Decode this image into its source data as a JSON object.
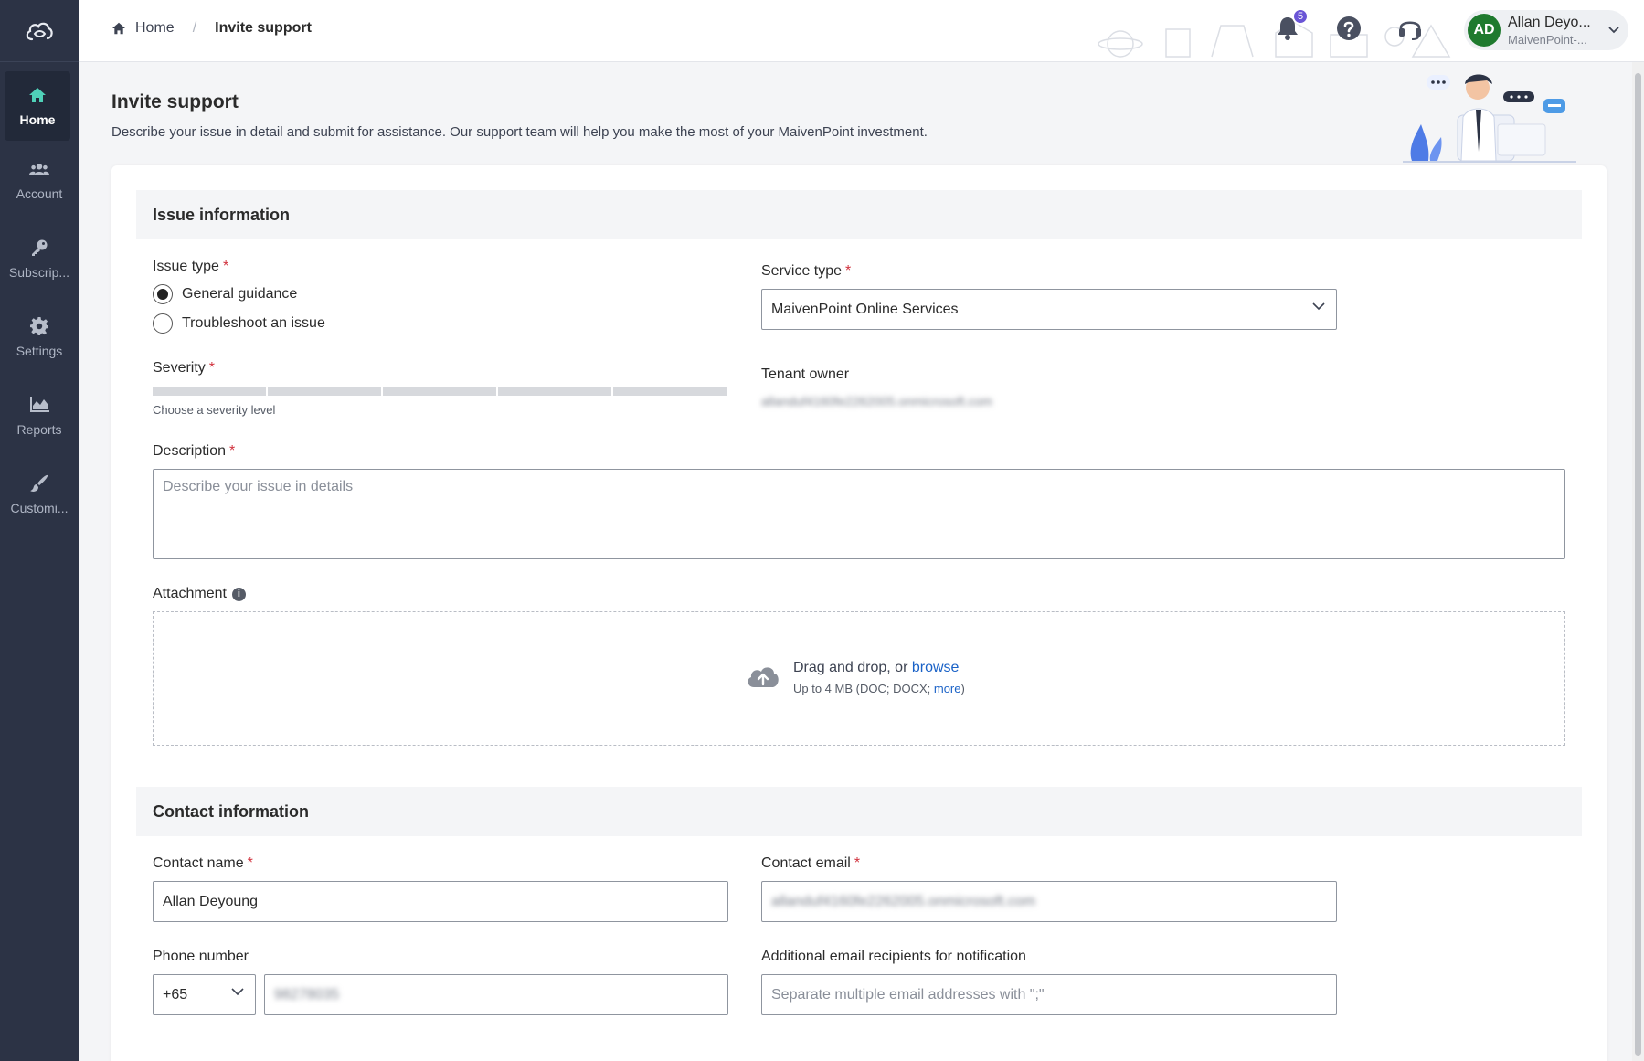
{
  "sidebar": {
    "items": [
      {
        "label": "Home",
        "icon": "home-icon",
        "active": true
      },
      {
        "label": "Account",
        "icon": "users-icon"
      },
      {
        "label": "Subscrip...",
        "icon": "key-icon"
      },
      {
        "label": "Settings",
        "icon": "gear-icon"
      },
      {
        "label": "Reports",
        "icon": "chart-icon"
      },
      {
        "label": "Customi...",
        "icon": "brush-icon"
      }
    ]
  },
  "header": {
    "breadcrumb": {
      "home": "Home",
      "separator": "/",
      "current": "Invite support"
    },
    "notifications_count": "5",
    "user": {
      "initials": "AD",
      "name": "Allan Deyo...",
      "org": "MaivenPoint-..."
    }
  },
  "page": {
    "title": "Invite support",
    "subtitle": "Describe your issue in detail and submit for assistance. Our support team will help you make the most of your MaivenPoint investment."
  },
  "issue_section": {
    "title": "Issue information",
    "issue_type": {
      "label": "Issue type",
      "options": [
        "General guidance",
        "Troubleshoot an issue"
      ],
      "selected": "General guidance"
    },
    "service_type": {
      "label": "Service type",
      "value": "MaivenPoint Online Services"
    },
    "severity": {
      "label": "Severity",
      "hint": "Choose a severity level",
      "levels": 5
    },
    "tenant_owner": {
      "label": "Tenant owner",
      "value": "allanduf4160fe2262005.onmicrosoft.com"
    },
    "description": {
      "label": "Description",
      "placeholder": "Describe your issue in details"
    },
    "attachment": {
      "label": "Attachment",
      "drag_text": "Drag and drop, or ",
      "browse_link": "browse",
      "limit_text": "Up to 4 MB (DOC; DOCX; ",
      "more_link": "more",
      "limit_close": ")"
    }
  },
  "contact_section": {
    "title": "Contact information",
    "contact_name": {
      "label": "Contact name",
      "value": "Allan Deyoung"
    },
    "contact_email": {
      "label": "Contact email",
      "value": "allanduf4160fe2262005.onmicrosoft.com"
    },
    "phone": {
      "label": "Phone number",
      "country_code": "+65",
      "number": "98278035"
    },
    "additional_emails": {
      "label": "Additional email recipients for notification",
      "placeholder": "Separate multiple email addresses with \";\""
    }
  },
  "required_marker": "*",
  "colors": {
    "sidebar": "#2c3345",
    "accent": "#4fd1b8",
    "avatar": "#1f7a2e",
    "link": "#1a62c7",
    "badge": "#6a55d6",
    "required": "#d1313d"
  }
}
